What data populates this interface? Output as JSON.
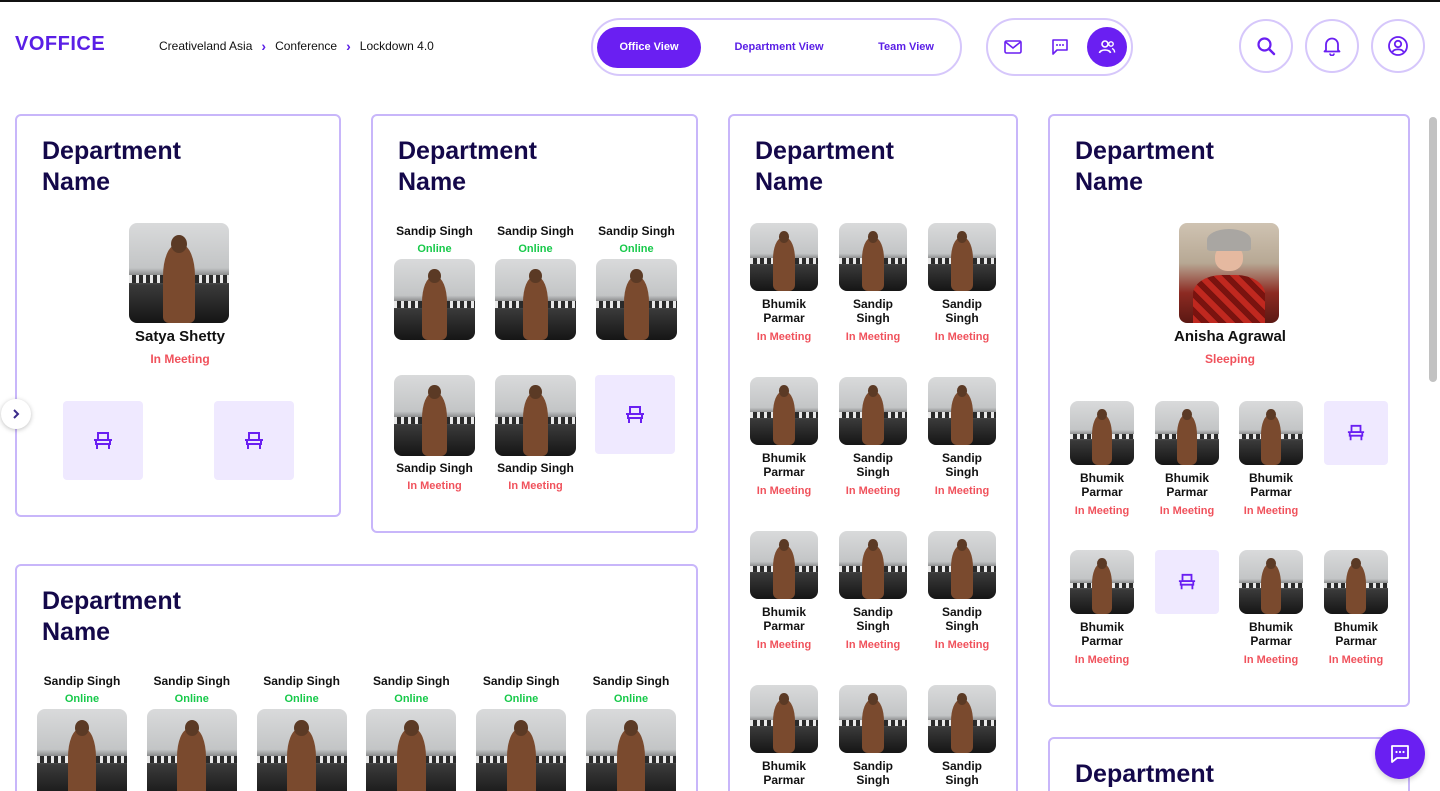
{
  "app": {
    "logo": "VOFFICE"
  },
  "breadcrumb": [
    "Creativeland Asia",
    "Conference",
    "Lockdown 4.0"
  ],
  "views": {
    "office": "Office View",
    "department": "Department View",
    "team": "Team View"
  },
  "colors": {
    "accent": "#6a1ff2",
    "online": "#17c94a",
    "in_meeting": "#f0525c",
    "seat_bg": "#efe9ff",
    "border": "#c8b6fa"
  },
  "icons": [
    "mail-icon",
    "chat-icon",
    "users-icon",
    "search-icon",
    "bell-icon",
    "profile-icon",
    "chair-icon",
    "chevron-right-icon"
  ],
  "cards": {
    "d1": {
      "title": "Department Name",
      "lead_name": "Satya Shetty",
      "lead_status": "In Meeting"
    },
    "d2": {
      "title": "Department Name",
      "top": [
        {
          "name": "Sandip Singh",
          "status": "Online"
        },
        {
          "name": "Sandip Singh",
          "status": "Online"
        },
        {
          "name": "Sandip Singh",
          "status": "Online"
        }
      ],
      "bottom": [
        {
          "name": "Sandip Singh",
          "status": "In Meeting"
        },
        {
          "name": "Sandip Singh",
          "status": "In Meeting"
        }
      ]
    },
    "d3": {
      "title": "Department Name",
      "rows": [
        [
          {
            "n1": "Bhumik",
            "n2": "Parmar",
            "status": "In Meeting"
          },
          {
            "n1": "Sandip",
            "n2": "Singh",
            "status": "In Meeting"
          },
          {
            "n1": "Sandip",
            "n2": "Singh",
            "status": "In Meeting"
          }
        ],
        [
          {
            "n1": "Bhumik",
            "n2": "Parmar",
            "status": "In Meeting"
          },
          {
            "n1": "Sandip",
            "n2": "Singh",
            "status": "In Meeting"
          },
          {
            "n1": "Sandip",
            "n2": "Singh",
            "status": "In Meeting"
          }
        ],
        [
          {
            "n1": "Bhumik",
            "n2": "Parmar",
            "status": "In Meeting"
          },
          {
            "n1": "Sandip",
            "n2": "Singh",
            "status": "In Meeting"
          },
          {
            "n1": "Sandip",
            "n2": "Singh",
            "status": "In Meeting"
          }
        ],
        [
          {
            "n1": "Bhumik",
            "n2": "Parmar",
            "status": ""
          },
          {
            "n1": "Sandip",
            "n2": "Singh",
            "status": ""
          },
          {
            "n1": "Sandip",
            "n2": "Singh",
            "status": ""
          }
        ]
      ]
    },
    "d4": {
      "title": "Department Name",
      "lead_name": "Anisha Agrawal",
      "lead_status": "Sleeping",
      "members": {
        "n1": "Bhumik",
        "n2": "Parmar",
        "status": "In Meeting"
      }
    },
    "d5": {
      "title": "Department Name",
      "members": [
        {
          "name": "Sandip Singh",
          "status": "Online"
        },
        {
          "name": "Sandip Singh",
          "status": "Online"
        },
        {
          "name": "Sandip Singh",
          "status": "Online"
        },
        {
          "name": "Sandip Singh",
          "status": "Online"
        },
        {
          "name": "Sandip Singh",
          "status": "Online"
        },
        {
          "name": "Sandip Singh",
          "status": "Online"
        }
      ]
    },
    "d6": {
      "title": "Department"
    }
  }
}
